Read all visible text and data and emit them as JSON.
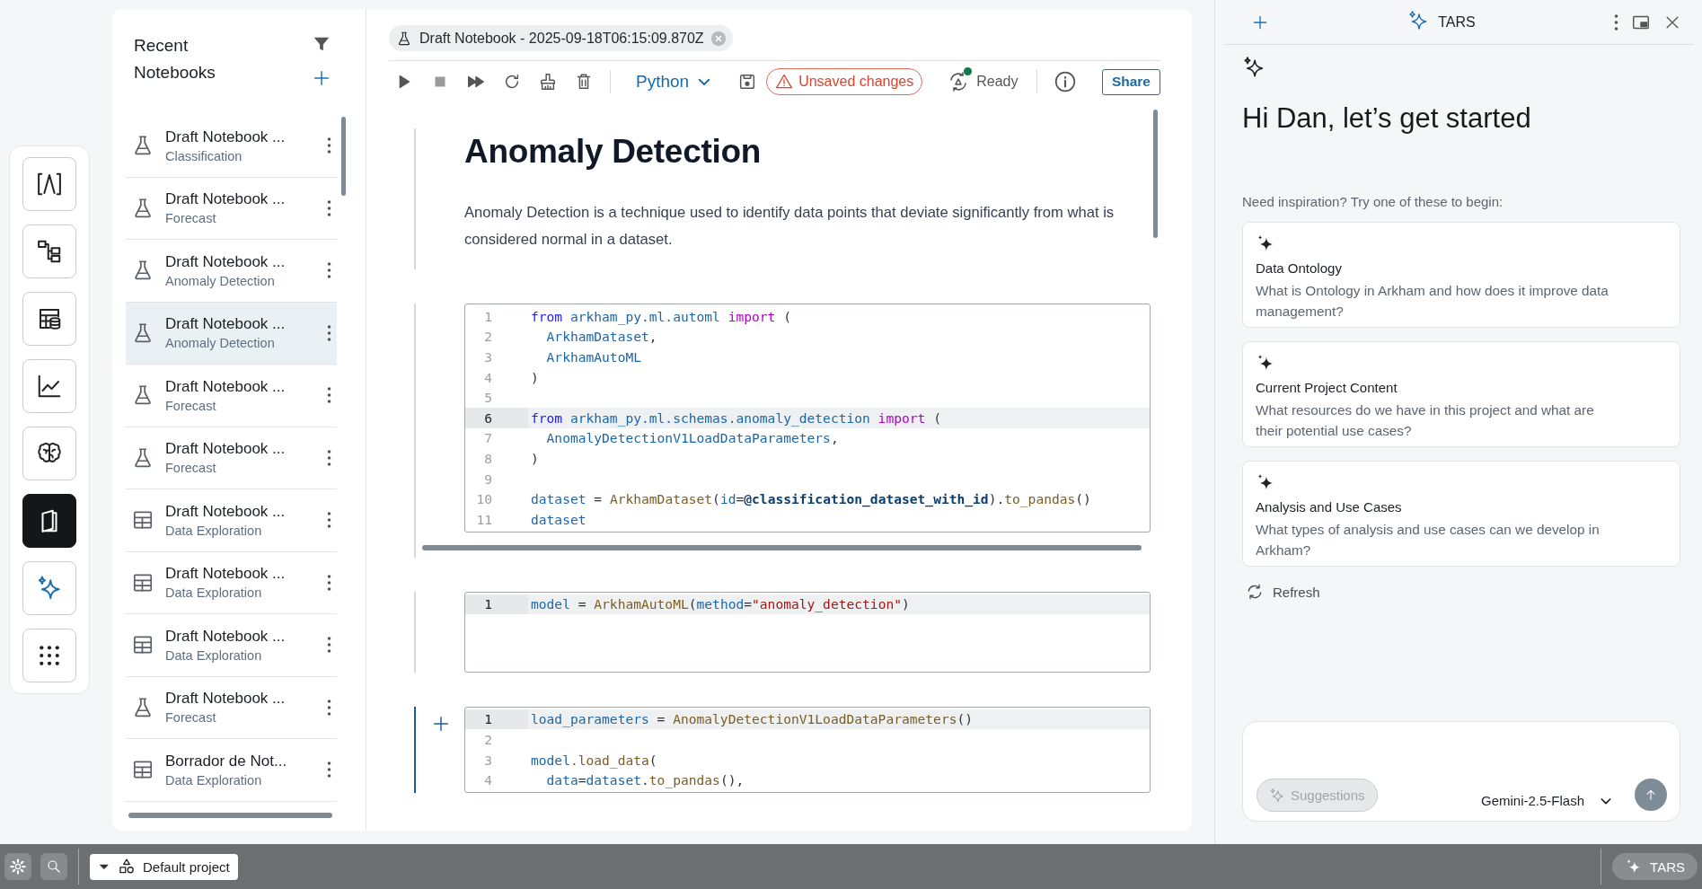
{
  "rail": [
    {
      "kind": "lambda",
      "selected": false
    },
    {
      "kind": "flow",
      "selected": false
    },
    {
      "kind": "table-db",
      "selected": false
    },
    {
      "kind": "chart",
      "selected": false
    },
    {
      "kind": "brain",
      "selected": false
    },
    {
      "kind": "notebook",
      "selected": true
    },
    {
      "kind": "sparkle",
      "selected": false
    },
    {
      "kind": "apps",
      "selected": false
    }
  ],
  "notebooks": {
    "title": "Recent Notebooks",
    "items": [
      {
        "kind": "flask",
        "title": "Draft Notebook ...",
        "subtitle": "Classification",
        "selected": false
      },
      {
        "kind": "flask",
        "title": "Draft Notebook ...",
        "subtitle": "Forecast",
        "selected": false
      },
      {
        "kind": "flask",
        "title": "Draft Notebook ...",
        "subtitle": "Anomaly Detection",
        "selected": false
      },
      {
        "kind": "flask",
        "title": "Draft Notebook ...",
        "subtitle": "Anomaly Detection",
        "selected": true
      },
      {
        "kind": "flask",
        "title": "Draft Notebook ...",
        "subtitle": "Forecast",
        "selected": false
      },
      {
        "kind": "flask",
        "title": "Draft Notebook ...",
        "subtitle": "Forecast",
        "selected": false
      },
      {
        "kind": "table",
        "title": "Draft Notebook ...",
        "subtitle": "Data Exploration",
        "selected": false
      },
      {
        "kind": "table",
        "title": "Draft Notebook ...",
        "subtitle": "Data Exploration",
        "selected": false
      },
      {
        "kind": "table",
        "title": "Draft Notebook ...",
        "subtitle": "Data Exploration",
        "selected": false
      },
      {
        "kind": "flask",
        "title": "Draft Notebook ...",
        "subtitle": "Forecast",
        "selected": false
      },
      {
        "kind": "table",
        "title": "Borrador de Not...",
        "subtitle": "Data Exploration",
        "selected": false
      }
    ]
  },
  "editor": {
    "tab": "Draft Notebook - 2025-09-18T06:15:09.870Z",
    "toolbar": {
      "language": "Python",
      "status_badge": "Unsaved changes",
      "kernel_status": "Ready",
      "share": "Share"
    },
    "cells": [
      {
        "kind": "markdown",
        "active": false,
        "heading": "Anomaly Detection",
        "text": "Anomaly Detection is a technique used to identify data points that deviate significantly from what is considered normal in a dataset."
      },
      {
        "kind": "code",
        "active": false,
        "lines": [
          {
            "number": "1",
            "highlighted": false,
            "tokens": [
              {
                "kind": "keyword",
                "text": "from "
              },
              {
                "kind": "name",
                "text": "arkham_py.ml.automl "
              },
              {
                "kind": "import",
                "text": "import "
              },
              {
                "kind": "punct",
                "text": "("
              }
            ]
          },
          {
            "number": "2",
            "highlighted": false,
            "tokens": [
              {
                "kind": "name",
                "text": "  ArkhamDataset"
              },
              {
                "kind": "punct",
                "text": ","
              }
            ]
          },
          {
            "number": "3",
            "highlighted": false,
            "tokens": [
              {
                "kind": "name",
                "text": "  ArkhamAutoML"
              }
            ]
          },
          {
            "number": "4",
            "highlighted": false,
            "tokens": [
              {
                "kind": "punct",
                "text": ")"
              }
            ]
          },
          {
            "number": "5",
            "highlighted": false
          },
          {
            "number": "6",
            "highlighted": true,
            "tokens": [
              {
                "kind": "keyword",
                "text": "from "
              },
              {
                "kind": "name",
                "text": "arkham_py.ml.schemas.anomaly_detection "
              },
              {
                "kind": "import",
                "text": "import "
              },
              {
                "kind": "punct",
                "text": "("
              }
            ]
          },
          {
            "number": "7",
            "highlighted": false,
            "tokens": [
              {
                "kind": "name",
                "text": "  AnomalyDetectionV1LoadDataParameters"
              },
              {
                "kind": "punct",
                "text": ","
              }
            ]
          },
          {
            "number": "8",
            "highlighted": false,
            "tokens": [
              {
                "kind": "punct",
                "text": ")"
              }
            ]
          },
          {
            "number": "9",
            "highlighted": false
          },
          {
            "number": "10",
            "highlighted": false,
            "tokens": [
              {
                "kind": "name",
                "text": "dataset"
              },
              {
                "kind": "punct",
                "text": " = "
              },
              {
                "kind": "call",
                "text": "ArkhamDataset"
              },
              {
                "kind": "punct",
                "text": "("
              },
              {
                "kind": "name",
                "text": "id"
              },
              {
                "kind": "punct",
                "text": "="
              },
              {
                "kind": "param",
                "text": "@classification_dataset_with_id"
              },
              {
                "kind": "punct",
                "text": ")."
              },
              {
                "kind": "call",
                "text": "to_pandas"
              },
              {
                "kind": "punct",
                "text": "()"
              }
            ]
          },
          {
            "number": "11",
            "highlighted": false,
            "tokens": [
              {
                "kind": "name",
                "text": "dataset"
              }
            ]
          }
        ]
      },
      {
        "kind": "code",
        "active": false,
        "lines": [
          {
            "number": "1",
            "highlighted": true,
            "tokens": [
              {
                "kind": "name",
                "text": "model"
              },
              {
                "kind": "punct",
                "text": " = "
              },
              {
                "kind": "call",
                "text": "ArkhamAutoML"
              },
              {
                "kind": "punct",
                "text": "("
              },
              {
                "kind": "name",
                "text": "method"
              },
              {
                "kind": "punct",
                "text": "="
              },
              {
                "kind": "string",
                "text": "\"anomaly_detection\""
              },
              {
                "kind": "punct",
                "text": ")"
              }
            ]
          }
        ]
      },
      {
        "kind": "code",
        "active": true,
        "lines": [
          {
            "number": "1",
            "highlighted": true,
            "tokens": [
              {
                "kind": "name",
                "text": "load_parameters"
              },
              {
                "kind": "punct",
                "text": " = "
              },
              {
                "kind": "call",
                "text": "AnomalyDetectionV1LoadDataParameters"
              },
              {
                "kind": "punct",
                "text": "()"
              }
            ]
          },
          {
            "number": "2",
            "highlighted": false
          },
          {
            "number": "3",
            "highlighted": false,
            "tokens": [
              {
                "kind": "name",
                "text": "model"
              },
              {
                "kind": "call",
                "text": ".load_data"
              },
              {
                "kind": "punct",
                "text": "("
              }
            ]
          },
          {
            "number": "4",
            "highlighted": false,
            "tokens": [
              {
                "kind": "name",
                "text": "  data"
              },
              {
                "kind": "punct",
                "text": "="
              },
              {
                "kind": "name",
                "text": "dataset"
              },
              {
                "kind": "punct",
                "text": "."
              },
              {
                "kind": "call",
                "text": "to_pandas"
              },
              {
                "kind": "punct",
                "text": "(),"
              }
            ]
          }
        ]
      }
    ]
  },
  "assistant": {
    "title": "TARS",
    "greeting": "Hi Dan, let’s get started",
    "prompt": "Need inspiration? Try one of these to begin:",
    "suggestions": [
      {
        "title": "Data Ontology",
        "text": "What is Ontology in Arkham and how does it improve data management?"
      },
      {
        "title": "Current Project Content",
        "text": "What resources do we have in this project and what are their potential use cases?"
      },
      {
        "title": "Analysis and Use Cases",
        "text": "What types of analysis and use cases can we develop in Arkham?"
      }
    ],
    "refresh": "Refresh",
    "composer": {
      "suggestions_button": "Suggestions",
      "suggestions_disabled": true,
      "model": "Gemini-2.5-Flash"
    }
  },
  "status_bar": {
    "project": "Default project",
    "assistant_button": "TARS"
  }
}
